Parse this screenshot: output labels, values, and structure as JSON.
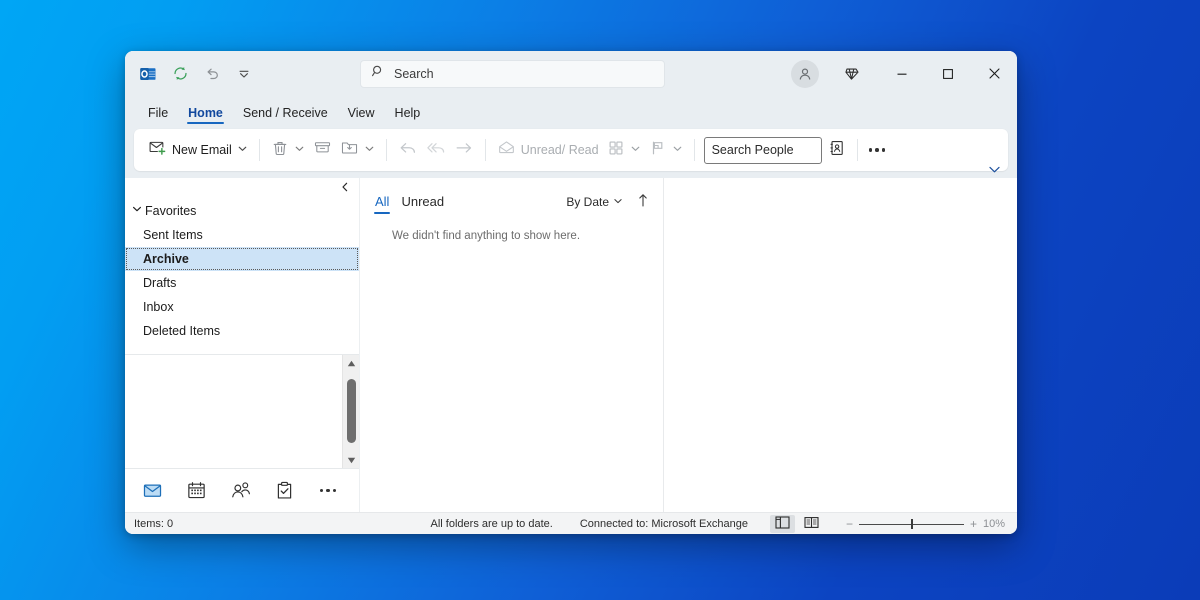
{
  "window": {
    "title": "Outlook",
    "quick_access": [
      {
        "name": "outlook-logo-icon",
        "label": "Outlook"
      },
      {
        "name": "send-receive-sync-icon",
        "label": "Send/Receive All Folders"
      },
      {
        "name": "undo-icon",
        "label": "Undo"
      },
      {
        "name": "customize-quick-access-toolbar-icon",
        "label": "Customize Quick Access Toolbar"
      }
    ],
    "search": {
      "placeholder": "Search",
      "value": "",
      "icon": "search-icon"
    },
    "account_icon": "account-avatar-icon",
    "premium_icon": "diamond-icon",
    "caption": {
      "minimize": "─",
      "maximize": "□",
      "close": "✕"
    }
  },
  "menubar": {
    "items": [
      {
        "label": "File",
        "active": false
      },
      {
        "label": "Home",
        "active": true
      },
      {
        "label": "Send / Receive",
        "active": false
      },
      {
        "label": "View",
        "active": false
      },
      {
        "label": "Help",
        "active": false
      }
    ]
  },
  "ribbon": {
    "new_email": {
      "label": "New Email",
      "icon": "new-email-icon"
    },
    "delete": {
      "label": "Delete",
      "icon": "delete-trash-icon"
    },
    "archive": {
      "label": "Archive",
      "icon": "archive-box-icon"
    },
    "move": {
      "label": "Move",
      "icon": "move-to-folder-icon"
    },
    "reply": {
      "label": "Reply",
      "icon": "reply-arrow-icon"
    },
    "reply_all": {
      "label": "Reply All",
      "icon": "reply-all-arrow-icon"
    },
    "forward": {
      "label": "Forward",
      "icon": "forward-arrow-icon"
    },
    "unread_read": {
      "label": "Unread/ Read",
      "icon": "unread-read-envelope-icon",
      "disabled": true
    },
    "categorize": {
      "label": "Categorize",
      "icon": "categorize-grid-icon"
    },
    "flag": {
      "label": "Follow Up",
      "icon": "flag-icon"
    },
    "search_people": {
      "placeholder": "Search People",
      "value": ""
    },
    "address_book": {
      "label": "Address Book",
      "icon": "address-book-icon"
    },
    "more_options": {
      "label": "More options",
      "icon": "ellipsis-icon"
    },
    "collapse": {
      "label": "Collapse the Ribbon",
      "icon": "chevron-down-icon"
    }
  },
  "folder_pane": {
    "collapse_icon": "chevron-left-icon",
    "group": {
      "label": "Favorites",
      "expanded": true,
      "chevron": "chevron-down-icon"
    },
    "folders": [
      {
        "label": "Sent Items",
        "selected": false
      },
      {
        "label": "Archive",
        "selected": true
      },
      {
        "label": "Drafts",
        "selected": false
      },
      {
        "label": "Inbox",
        "selected": false
      },
      {
        "label": "Deleted Items",
        "selected": false
      }
    ],
    "scrollbar": {
      "up_icon": "scroll-up-arrow-icon",
      "down_icon": "scroll-down-arrow-icon"
    },
    "nav": [
      {
        "name": "nav-mail",
        "label": "Mail",
        "icon": "mail-icon",
        "active": true
      },
      {
        "name": "nav-calendar",
        "label": "Calendar",
        "icon": "calendar-icon",
        "active": false
      },
      {
        "name": "nav-people",
        "label": "People",
        "icon": "people-icon",
        "active": false
      },
      {
        "name": "nav-tasks",
        "label": "Tasks",
        "icon": "tasks-clipboard-icon",
        "active": false
      },
      {
        "name": "nav-more",
        "label": "More",
        "icon": "ellipsis-icon",
        "active": false
      }
    ]
  },
  "message_list": {
    "tabs": [
      {
        "label": "All",
        "active": true
      },
      {
        "label": "Unread",
        "active": false
      }
    ],
    "sort": {
      "label": "By Date",
      "chevron": "chevron-down-icon",
      "direction_icon": "sort-ascending-arrow-icon"
    },
    "empty_text": "We didn't find anything to show here."
  },
  "status_bar": {
    "items_count": "Items: 0",
    "sync_status": "All folders are up to date.",
    "connection": "Connected to: Microsoft Exchange",
    "views": [
      {
        "name": "normal-view-button",
        "icon": "normal-view-icon",
        "active": true
      },
      {
        "name": "reading-view-button",
        "icon": "reading-view-icon",
        "active": false
      }
    ],
    "zoom": {
      "minus": "−",
      "plus": "+",
      "level": "10%"
    }
  },
  "colors": {
    "accent": "#1767c0",
    "selection": "#cde3f7",
    "ribbon_bg": "#e9eef2",
    "outlook_blue": "#0f6cbd",
    "sync_green": "#3aa05a"
  }
}
